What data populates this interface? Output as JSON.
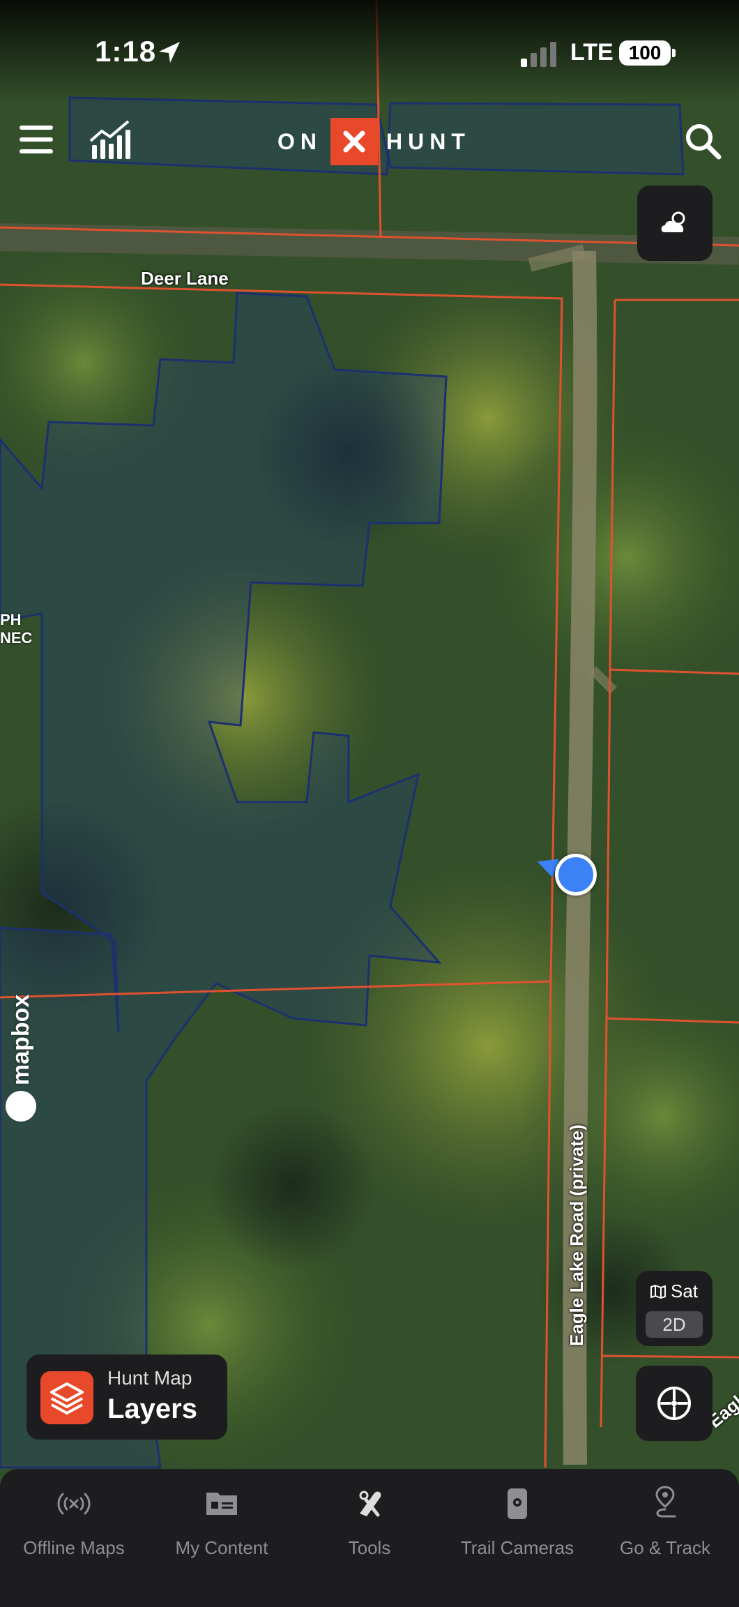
{
  "status_bar": {
    "time": "1:18",
    "network": "LTE",
    "battery": "100"
  },
  "header": {
    "logo_left": "ON",
    "logo_mark": "✕",
    "logo_right": "HUNT"
  },
  "map": {
    "road_labels": {
      "deer_lane": "Deer Lane",
      "eagle_lake": "Eagle Lake Road (private)",
      "eagle_partial": "Eagle"
    },
    "partial_label_lines": [
      "PH",
      "NEC"
    ],
    "attribution": "mapbox"
  },
  "controls": {
    "sat_label": "Sat",
    "mode_label": "2D",
    "layers_subtitle": "Hunt Map",
    "layers_title": "Layers"
  },
  "tabs": [
    {
      "label": "Offline Maps",
      "icon": "offline-signal-icon"
    },
    {
      "label": "My Content",
      "icon": "content-card-icon"
    },
    {
      "label": "Tools",
      "icon": "tools-icon"
    },
    {
      "label": "Trail Cameras",
      "icon": "trail-camera-icon"
    },
    {
      "label": "Go & Track",
      "icon": "route-pin-icon"
    }
  ],
  "colors": {
    "brand": "#e8492a",
    "parcel_line": "#e0522f",
    "public_land": "#1f3a78",
    "location": "#3b82f6"
  }
}
